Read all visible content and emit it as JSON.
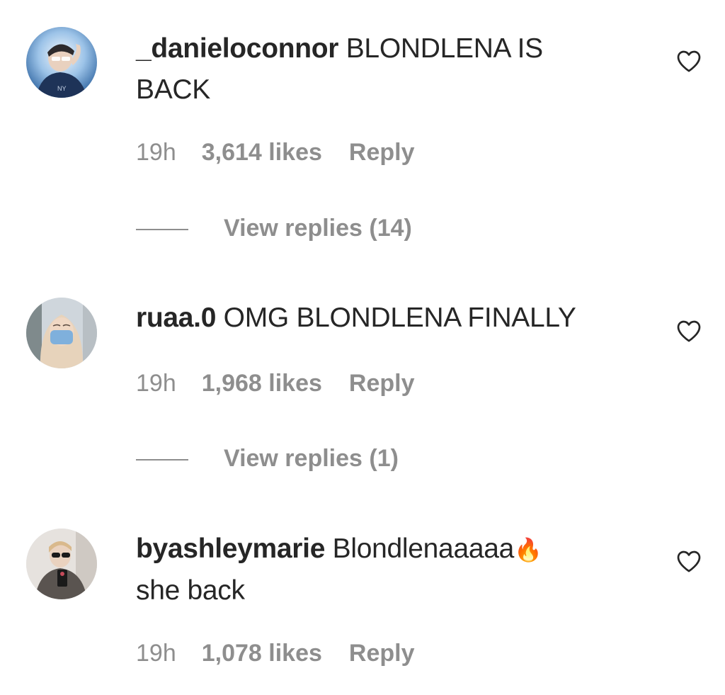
{
  "comments": [
    {
      "username": "_danieloconnor",
      "text": "BLONDLENA IS BACK",
      "time": "19h",
      "likes": "3,614 likes",
      "reply": "Reply",
      "view_replies": "View replies (14)",
      "liked": false
    },
    {
      "username": "ruaa.0",
      "text": "OMG BLONDLENA FINALLY",
      "time": "19h",
      "likes": "1,968 likes",
      "reply": "Reply",
      "view_replies": "View replies (1)",
      "liked": false
    },
    {
      "username": "byashleymarie",
      "text": "Blondlenaaaaa",
      "emoji": "🔥",
      "text_line2": "she back",
      "time": "19h",
      "likes": "1,078 likes",
      "reply": "Reply",
      "liked": false
    }
  ],
  "colors": {
    "text": "#262626",
    "secondary": "#8e8e8e",
    "background": "#ffffff"
  },
  "icons": {
    "like": "heart-outline-icon",
    "fire": "fire-emoji"
  }
}
